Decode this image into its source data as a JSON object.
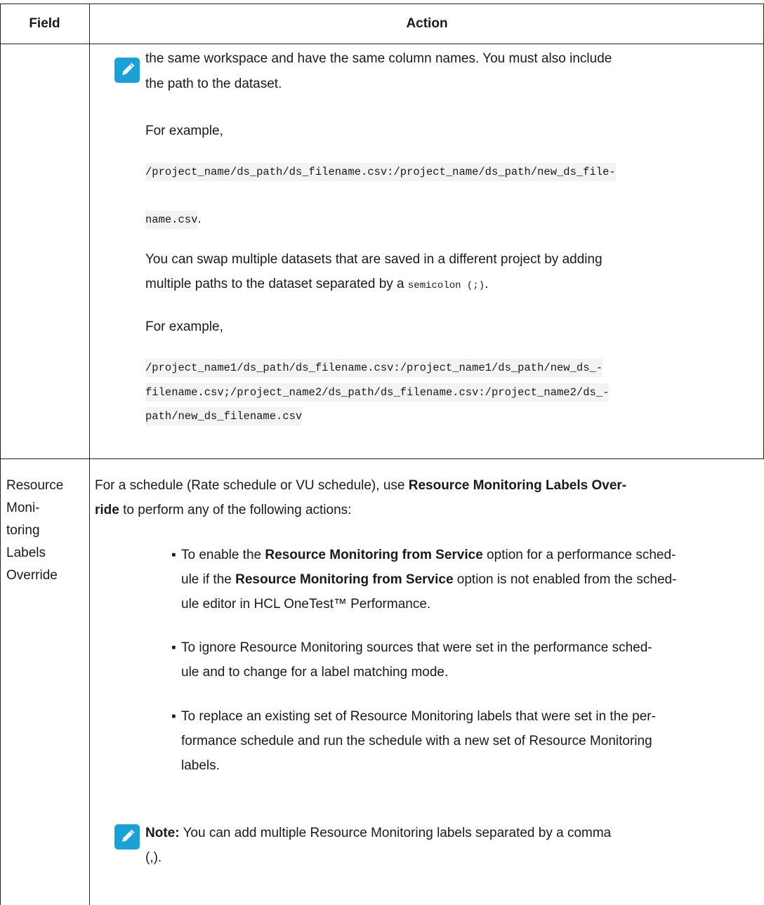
{
  "table": {
    "header": {
      "field": "Field",
      "action": "Action"
    },
    "row1": {
      "cont_line1": "the same workspace and have the same column names. You must also include",
      "cont_line2": "the path to the dataset.",
      "example1_label": "For example,",
      "code1_line1": "/project_name/ds_path/ds_filename.csv:/project_name/ds_path/new_ds_file-",
      "code1_line2": "name.csv",
      "code1_period": ".",
      "swap_line1": "You can swap multiple datasets that are saved in a different project by adding",
      "swap_line2_pre": "multiple paths to the dataset separated by a ",
      "swap_code": "semicolon (;)",
      "swap_period": ".",
      "example2_label": "For example,",
      "code2_line1": "/project_name1/ds_path/ds_filename.csv:/project_name1/ds_path/new_ds_-",
      "code2_line2": "filename.csv;/project_name2/ds_path/ds_filename.csv:/project_name2/ds_-",
      "code2_line3": "path/new_ds_filename.csv"
    },
    "row2": {
      "field_lines": [
        "Resource",
        "Moni-",
        "toring",
        "Labels",
        "Override"
      ],
      "intro_pre": "For a schedule (Rate schedule or VU schedule), use ",
      "intro_bold_a": "Resource Monitoring Labels Over-",
      "intro_bold_b": "ride",
      "intro_post": " to perform any of the following actions:",
      "bullet1": {
        "l1_pre": "To enable the ",
        "l1_bold": "Resource Monitoring from Service",
        "l1_post": " option for a performance sched-",
        "l2_pre": "ule if the ",
        "l2_bold": "Resource Monitoring from Service",
        "l2_post": " option is not enabled from the sched-",
        "l3": "ule editor in HCL OneTest™ Performance."
      },
      "bullet2": {
        "l1": "To ignore Resource Monitoring sources that were set in the performance sched-",
        "l2": "ule and to change for a label matching mode."
      },
      "bullet3": {
        "l1": "To replace an existing set of Resource Monitoring labels that were set in the per-",
        "l2": "formance schedule and run the schedule with a new set of Resource Monitoring",
        "l3": "labels."
      },
      "note_label": "Note:",
      "note_l1": " You can add multiple Resource Monitoring labels separated by a comma",
      "note_l2": "(,)."
    }
  },
  "icons": {
    "note": "pencil-note-icon",
    "accent": "#1ba0d8"
  },
  "bullet_glyph": "▪"
}
